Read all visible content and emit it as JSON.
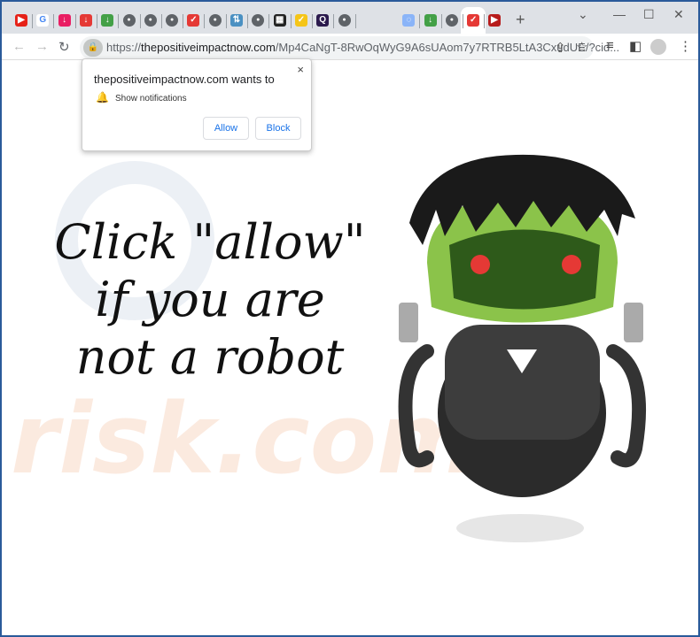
{
  "tabs": [
    {
      "icon": "youtube-icon",
      "color": "#e62117",
      "glyph": "▶"
    },
    {
      "icon": "google-icon",
      "color": "#ffffff",
      "glyph": "G"
    },
    {
      "icon": "download-icon",
      "color": "#e91e63",
      "glyph": "↓"
    },
    {
      "icon": "download-icon",
      "color": "#e53935",
      "glyph": "↓"
    },
    {
      "icon": "download-icon",
      "color": "#43a047",
      "glyph": "↓"
    },
    {
      "icon": "globe-icon",
      "color": "#5f6368",
      "glyph": "●"
    },
    {
      "icon": "globe-icon",
      "color": "#5f6368",
      "glyph": "●"
    },
    {
      "icon": "globe-icon",
      "color": "#5f6368",
      "glyph": "●"
    },
    {
      "icon": "pocket-icon",
      "color": "#e53935",
      "glyph": "✓"
    },
    {
      "icon": "globe-icon",
      "color": "#5f6368",
      "glyph": "●"
    },
    {
      "icon": "sync-icon",
      "color": "#4a90c2",
      "glyph": "⇅"
    },
    {
      "icon": "globe-icon",
      "color": "#5f6368",
      "glyph": "●"
    },
    {
      "icon": "news-icon",
      "color": "#222222",
      "glyph": "▦"
    },
    {
      "icon": "check-icon",
      "color": "#f5c518",
      "glyph": "✓"
    },
    {
      "icon": "q-icon",
      "color": "#2b1a4d",
      "glyph": "Q"
    },
    {
      "icon": "globe-icon",
      "color": "#5f6368",
      "glyph": "●"
    },
    {
      "icon": "blank-icon",
      "color": "#dee1e6",
      "glyph": ""
    },
    {
      "icon": "loading-icon",
      "color": "#8ab4f8",
      "glyph": "◌"
    },
    {
      "icon": "download-icon",
      "color": "#43a047",
      "glyph": "↓"
    },
    {
      "icon": "globe-icon",
      "color": "#5f6368",
      "glyph": "●"
    },
    {
      "icon": "pocket-icon",
      "color": "#e53935",
      "glyph": "✓"
    }
  ],
  "active_tab_close": "×",
  "last_tab": {
    "icon": "youtube-icon",
    "color": "#b71c1c",
    "glyph": "▶"
  },
  "new_tab": "+",
  "window": {
    "minimize": "—",
    "maximize": "☐",
    "close": "✕",
    "dropdown": "⌄"
  },
  "address": {
    "scheme": "https://",
    "domain": "thepositiveimpactnow.com",
    "path": "/Mp4CaNgT-8RwOqWyG9A6sUAom7y7RTRB5LtA3CxudUE/?cid..."
  },
  "popup": {
    "title": "thepositiveimpactnow.com wants to",
    "permission": "Show notifications",
    "allow": "Allow",
    "block": "Block",
    "close": "×"
  },
  "page": {
    "line1": "Click \"allow\"",
    "line2": "if you are",
    "line3": "not a robot"
  },
  "watermark": "risk.com"
}
